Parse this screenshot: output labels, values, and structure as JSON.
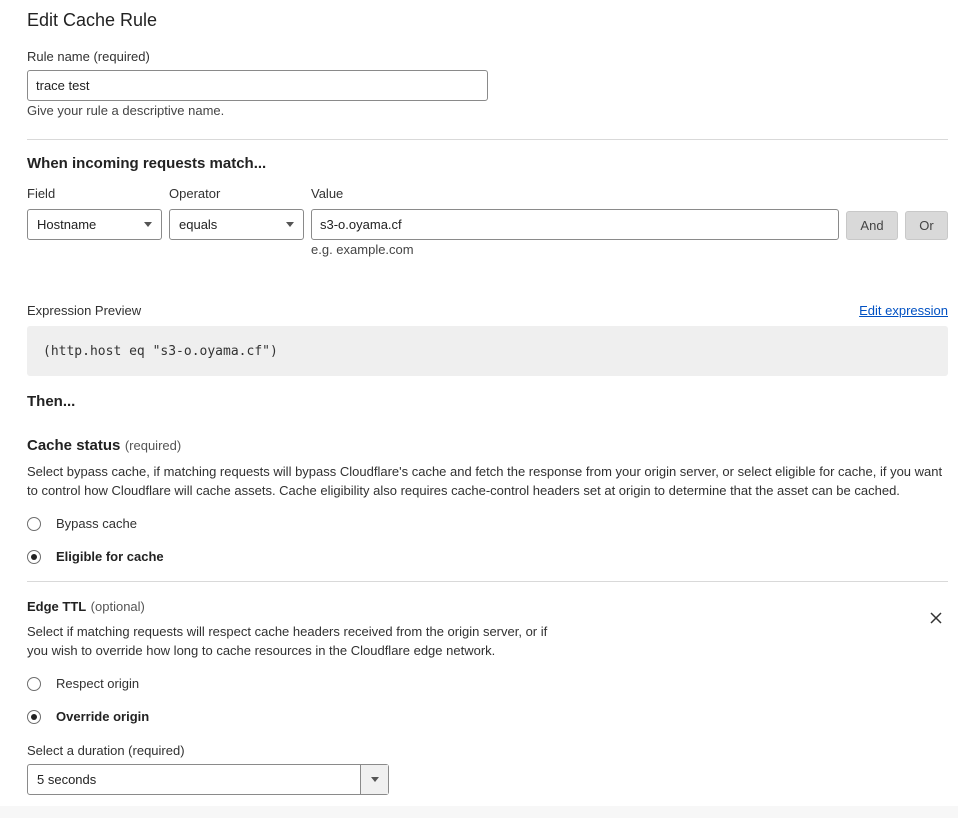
{
  "page": {
    "title": "Edit Cache Rule"
  },
  "rule_name": {
    "label": "Rule name (required)",
    "value": "trace test",
    "help": "Give your rule a descriptive name."
  },
  "match": {
    "heading": "When incoming requests match...",
    "field_label": "Field",
    "operator_label": "Operator",
    "value_label": "Value",
    "field_value": "Hostname",
    "operator_value": "equals",
    "value_input": "s3-o.oyama.cf",
    "value_hint": "e.g. example.com",
    "and_label": "And",
    "or_label": "Or"
  },
  "expression": {
    "label": "Expression Preview",
    "edit_link": "Edit expression",
    "code": "(http.host eq \"s3-o.oyama.cf\")"
  },
  "then": {
    "heading": "Then..."
  },
  "cache_status": {
    "title": "Cache status",
    "qualifier": "(required)",
    "description": "Select bypass cache, if matching requests will bypass Cloudflare's cache and fetch the response from your origin server, or select eligible for cache, if you want to control how Cloudflare will cache assets. Cache eligibility also requires cache-control headers set at origin to determine that the asset can be cached.",
    "options": [
      {
        "label": "Bypass cache",
        "checked": false
      },
      {
        "label": "Eligible for cache",
        "checked": true
      }
    ]
  },
  "edge_ttl": {
    "title": "Edge TTL",
    "qualifier": "(optional)",
    "description": "Select if matching requests will respect cache headers received from the origin server, or if you wish to override how long to cache resources in the Cloudflare edge network.",
    "options": [
      {
        "label": "Respect origin",
        "checked": false
      },
      {
        "label": "Override origin",
        "checked": true
      }
    ],
    "duration_label": "Select a duration (required)",
    "duration_value": "5 seconds"
  },
  "colors": {
    "link": "#0051c3",
    "button_bg": "#d9d9d9",
    "code_bg": "#efefef"
  },
  "icons": {
    "close": "close-icon",
    "dropdown": "chevron-down-icon"
  }
}
